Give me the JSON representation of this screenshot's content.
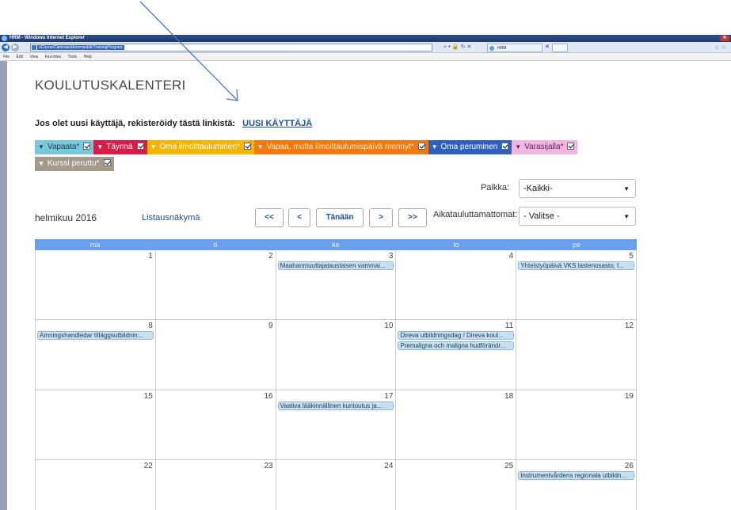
{
  "browser": {
    "title": "HRM - Windows Internet Explorer",
    "url_text": "…",
    "url_selected": "oCourseCalendar&from=publicTrainingProgram",
    "tab_label": "HRM",
    "menu": [
      "File",
      "Edit",
      "View",
      "Favorites",
      "Tools",
      "Help"
    ]
  },
  "page": {
    "title": "KOULUTUSKALENTERI",
    "register_text": "Jos olet uusi käyttäjä, rekisteröidy tästä linkistä:",
    "register_link": "UUSI KÄYTTÄJÄ"
  },
  "legend": [
    {
      "label": "Vapaata*",
      "bg": "#79c8dc",
      "fg": "#1c3e4a"
    },
    {
      "label": "Täynnä",
      "bg": "#d81c48",
      "fg": "#ffffff"
    },
    {
      "label": "Oma ilmoittautuminen*",
      "bg": "#f4b400",
      "fg": "#ffffff"
    },
    {
      "label": "Vapaa, mutta ilmoittautumispäivä mennyt*",
      "bg": "#f07a10",
      "fg": "#ffe9c8"
    },
    {
      "label": "Oma peruminen",
      "bg": "#2f5fc0",
      "fg": "#ffffff"
    },
    {
      "label": "Varasijalla*",
      "bg": "#f2b4e0",
      "fg": "#5a2a50"
    },
    {
      "label": "Kurssi peruttu*",
      "bg": "#a39a8c",
      "fg": "#ffffff"
    }
  ],
  "filters": {
    "paikka_label": "Paikka:",
    "paikka_value": "-Kaikki-",
    "aika_label": "Aikatauluttamattomat:",
    "aika_value": "- Valitse -"
  },
  "nav": {
    "month": "helmikuu 2016",
    "list_view": "Listausnäkymä",
    "prev_year": "<<",
    "prev": "<",
    "today": "Tänään",
    "next": ">",
    "next_year": ">>"
  },
  "calendar": {
    "weekdays": [
      "ma",
      "ti",
      "ke",
      "to",
      "pe"
    ],
    "weeks": [
      [
        {
          "day": "1",
          "events": []
        },
        {
          "day": "2",
          "events": []
        },
        {
          "day": "3",
          "events": [
            "Maahanmuuttajataustaisen vammai..."
          ]
        },
        {
          "day": "4",
          "events": []
        },
        {
          "day": "5",
          "events": [
            "Yhteistyöpäivä VKS lastenosasto, I..."
          ]
        }
      ],
      [
        {
          "day": "8",
          "events": [
            "Amningshandledar tilläggsutbildnin..."
          ]
        },
        {
          "day": "9",
          "events": []
        },
        {
          "day": "10",
          "events": []
        },
        {
          "day": "11",
          "events": [
            "Direva utbildningsdag / Direva koul...",
            "Premaligna och maligna hudförändr..."
          ]
        },
        {
          "day": "12",
          "events": []
        }
      ],
      [
        {
          "day": "15",
          "events": []
        },
        {
          "day": "16",
          "events": []
        },
        {
          "day": "17",
          "events": [
            "Vaativa lääkinnällinen kuntoutus ja..."
          ]
        },
        {
          "day": "18",
          "events": []
        },
        {
          "day": "19",
          "events": []
        }
      ],
      [
        {
          "day": "22",
          "events": []
        },
        {
          "day": "23",
          "events": []
        },
        {
          "day": "24",
          "events": []
        },
        {
          "day": "25",
          "events": []
        },
        {
          "day": "26",
          "events": [
            "Instrumentvårdens regionala utbildn..."
          ]
        }
      ]
    ]
  }
}
